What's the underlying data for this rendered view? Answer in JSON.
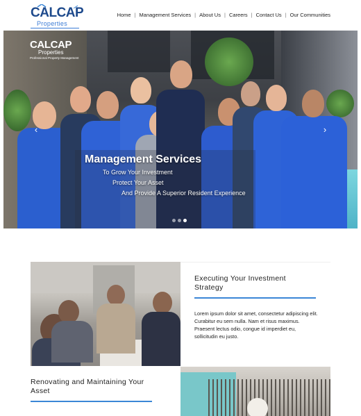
{
  "brand": {
    "logo_text": "CALCAP",
    "logo_sub": "Properties",
    "tagline": "Professional Property Management",
    "accent": "#3a86d6",
    "brand_blue": "#1e4a8c"
  },
  "nav": {
    "items": [
      "Home",
      "Management Services",
      "About Us",
      "Careers",
      "Contact Us",
      "Our Communities"
    ],
    "separator": "|"
  },
  "hero": {
    "title": "Management Services",
    "lines": [
      "To Grow Your Investment",
      "Protect Your Asset",
      "And Provide A Superior Resident Experience"
    ],
    "prev_icon": "chevron-left-icon",
    "next_icon": "chevron-right-icon",
    "prev_glyph": "‹",
    "next_glyph": "›",
    "slides_count": 3,
    "active_slide": 3
  },
  "features": [
    {
      "title": "Executing Your Investment Strategy",
      "body": "Lorem ipsum dolor sit amet, consectetur adipiscing elit. Curabitur eu sem nulla. Nam et risus maximus. Praesent lectus odio, congue id imperdiet eu, sollicitudin eu justo."
    },
    {
      "title": "Renovating and Maintaining Your Asset",
      "body": ""
    }
  ]
}
